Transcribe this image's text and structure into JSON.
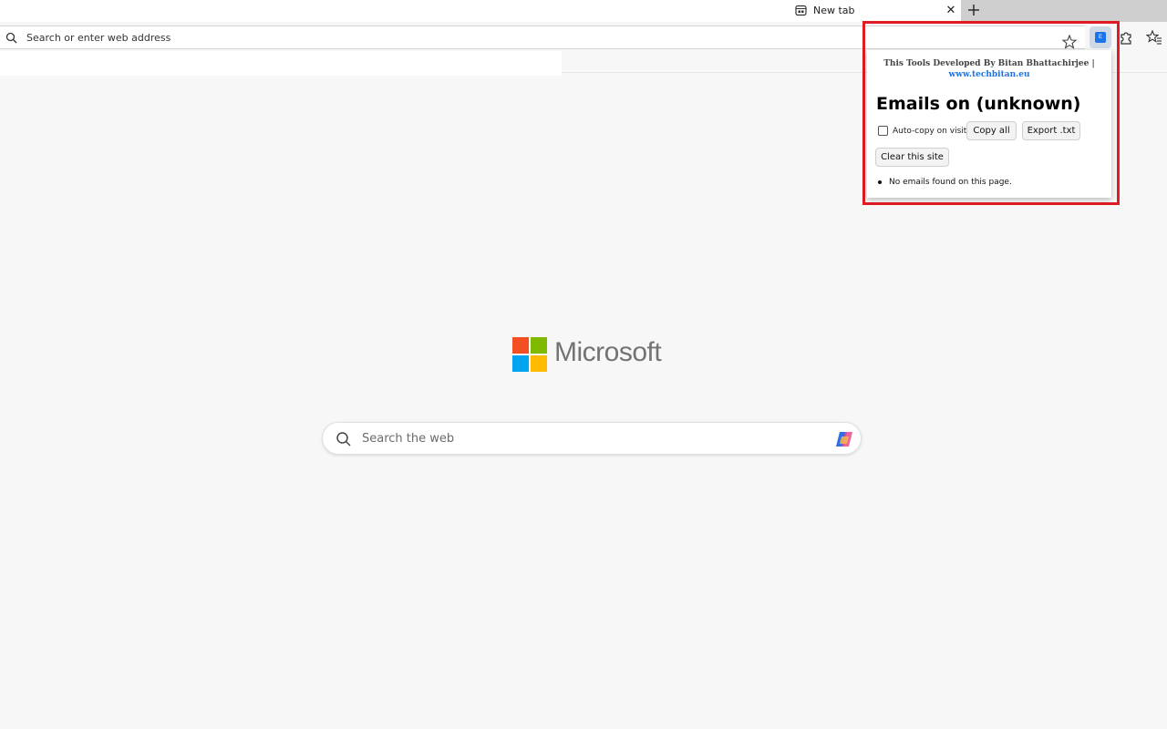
{
  "browser": {
    "tab": {
      "label": "New tab",
      "close_glyph": "✕"
    },
    "addressbar": {
      "placeholder": "Search or enter web address"
    },
    "extension_tile_letter": "E"
  },
  "newtab_page": {
    "logo_text": "Microsoft",
    "search_placeholder": "Search the web"
  },
  "popup": {
    "header_line1": "This Tools Developed By Bitan Bhattachirjee |",
    "header_link": "www.techbitan.eu",
    "title": "Emails on (unknown)",
    "autocopy_label": "Auto-copy on visit",
    "autocopy_checked": false,
    "copy_all_label": "Copy all",
    "export_label": "Export .txt",
    "clear_label": "Clear this site",
    "results": [
      "No emails found on this page."
    ]
  },
  "colors": {
    "highlight": "#e01b24",
    "link": "#1a73e8",
    "ms_red": "#f25022",
    "ms_green": "#7fba00",
    "ms_blue": "#00a4ef",
    "ms_yellow": "#ffb900"
  }
}
